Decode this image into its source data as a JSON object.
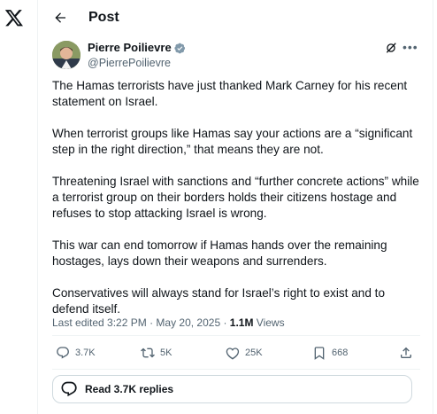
{
  "nav": {
    "logo_icon": "x-logo-icon"
  },
  "header": {
    "back_icon": "arrow-left-icon",
    "title": "Post"
  },
  "author": {
    "name": "Pierre Poilievre",
    "handle": "@PierrePoilievre",
    "verified_color": "#829aab"
  },
  "tweet": {
    "paragraphs": [
      "The Hamas terrorists have just thanked Mark Carney for his recent statement on Israel.",
      "When terrorist groups like Hamas say your actions are a “significant step in the right direction,” that means they are not.",
      "Threatening Israel with sanctions and “further concrete actions” while a terrorist group on their borders holds their citizens hostage and refuses to stop attacking Israel is wrong.",
      "This war can end tomorrow if Hamas hands over the remaining hostages, lays down their weapons and surrenders.",
      "Conservatives will always stand for Israel’s right to exist and to defend itself."
    ]
  },
  "meta": {
    "edited": "Last edited 3:22 PM · May 20, 2025 · ",
    "views_count": "1.1M",
    "views_label": " Views"
  },
  "actions": {
    "replies": "3.7K",
    "reposts": "5K",
    "likes": "25K",
    "bookmarks": "668"
  },
  "replies_button": {
    "label": "Read 3.7K replies"
  }
}
